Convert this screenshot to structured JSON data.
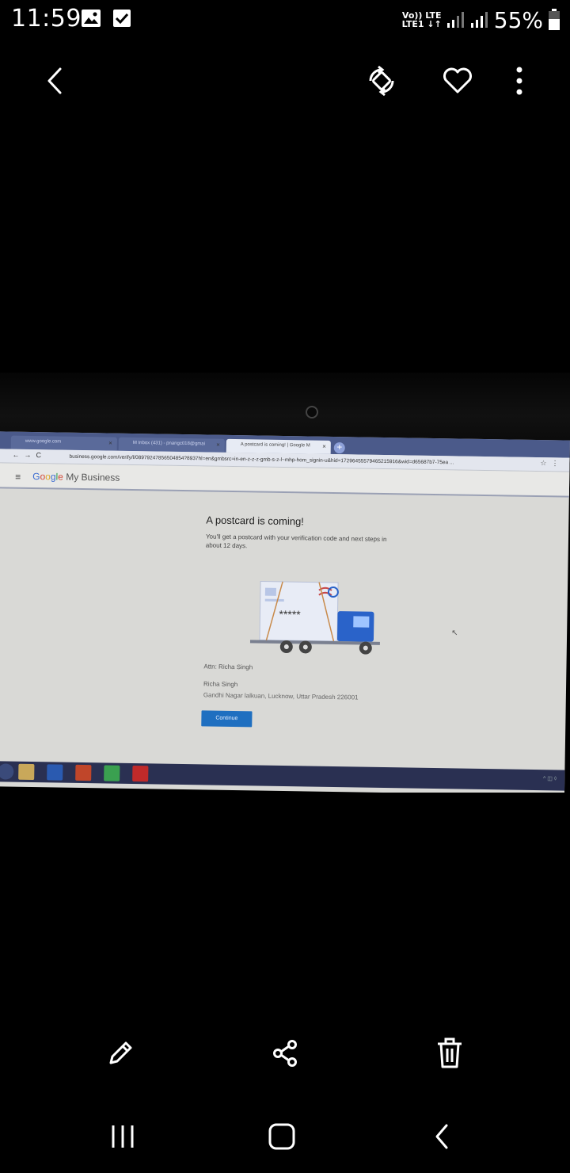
{
  "status_bar": {
    "time": "11:59",
    "network_top": "Vo)) LTE",
    "network_bottom": "LTE1 ↓↑",
    "battery_percent": "55%"
  },
  "toolbar": {
    "back_icon": "chevron-left-icon",
    "rotate_icon": "rotate-icon",
    "favorite_icon": "heart-icon",
    "more_icon": "more-vertical-icon"
  },
  "photo": {
    "browser_tabs": [
      {
        "label": "www.google.com"
      },
      {
        "label": "M  Inbox (431) - pnangc018@gmai"
      },
      {
        "label": "A postcard is coming! | Google M"
      }
    ],
    "url": "business.google.com/verify/l/08979247856504854?8937hl=en&gmbsrc=in-en-z-z-z-gmb-s-z-l~mhp-hom_signin-u&hid=17296455579465215916&wid=d65687b7-75ea ...",
    "gmb_logo": {
      "g": "G",
      "o1": "o",
      "o2": "o",
      "g2": "g",
      "l": "l",
      "e": "e",
      "suffix": "My Business"
    },
    "title": "A postcard is coming!",
    "description": "You'll get a postcard with your verification code and next steps in about 12 days.",
    "truck_code": "*****",
    "attn": "Attn: Richa Singh",
    "name": "Richa Singh",
    "address": "Gandhi Nagar lalkuan, Lucknow, Uttar Pradesh 226001",
    "continue_label": "Continue"
  },
  "actions": {
    "edit_icon": "pencil-icon",
    "share_icon": "share-icon",
    "delete_icon": "trash-icon"
  },
  "navigation": {
    "recents_icon": "recents-icon",
    "home_icon": "home-icon",
    "back_icon": "back-icon"
  },
  "colors": {
    "background": "#000000",
    "continue_button": "#1f6fc0",
    "truck_blue": "#2a63c9"
  }
}
